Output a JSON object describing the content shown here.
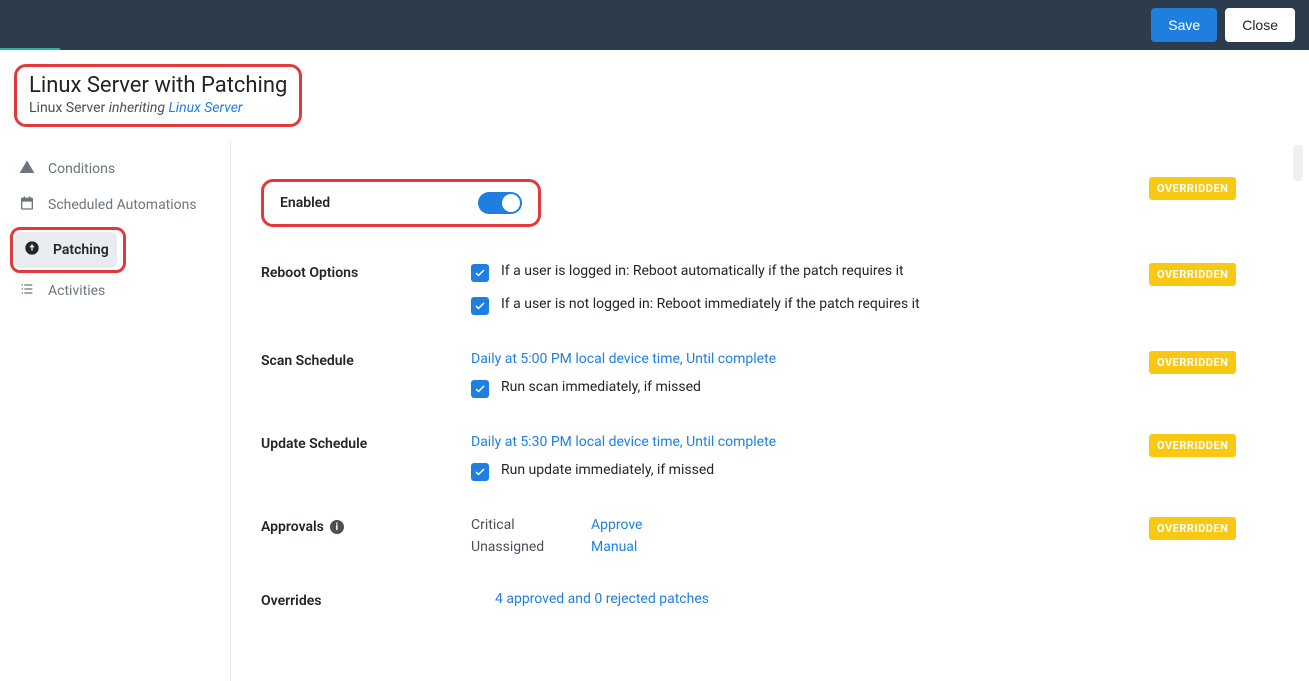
{
  "header": {
    "save_label": "Save",
    "close_label": "Close"
  },
  "page": {
    "title": "Linux Server with Patching",
    "subtitle_prefix": "Linux Server ",
    "subtitle_inherit_word": "inheriting ",
    "subtitle_link": "Linux Server"
  },
  "sidebar": {
    "items": [
      {
        "label": "Conditions"
      },
      {
        "label": "Scheduled Automations"
      },
      {
        "label": "Patching"
      },
      {
        "label": "Activities"
      }
    ]
  },
  "badges": {
    "overridden": "OVERRIDDEN"
  },
  "sections": {
    "enabled": {
      "label": "Enabled",
      "state": "on"
    },
    "reboot": {
      "label": "Reboot Options",
      "line1": "If a user is logged in: Reboot automatically if the patch requires it",
      "line2": "If a user is not logged in: Reboot immediately if the patch requires it"
    },
    "scan": {
      "label": "Scan Schedule",
      "link": "Daily at 5:00 PM local device time, Until complete",
      "missed": "Run scan immediately, if missed"
    },
    "update": {
      "label": "Update Schedule",
      "link": "Daily at 5:30 PM local device time, Until complete",
      "missed": "Run update immediately, if missed"
    },
    "approvals": {
      "label": "Approvals",
      "rows": [
        {
          "k": "Critical",
          "v": "Approve"
        },
        {
          "k": "Unassigned",
          "v": "Manual"
        }
      ]
    },
    "overrides": {
      "label": "Overrides",
      "link": "4 approved and 0 rejected patches"
    }
  }
}
